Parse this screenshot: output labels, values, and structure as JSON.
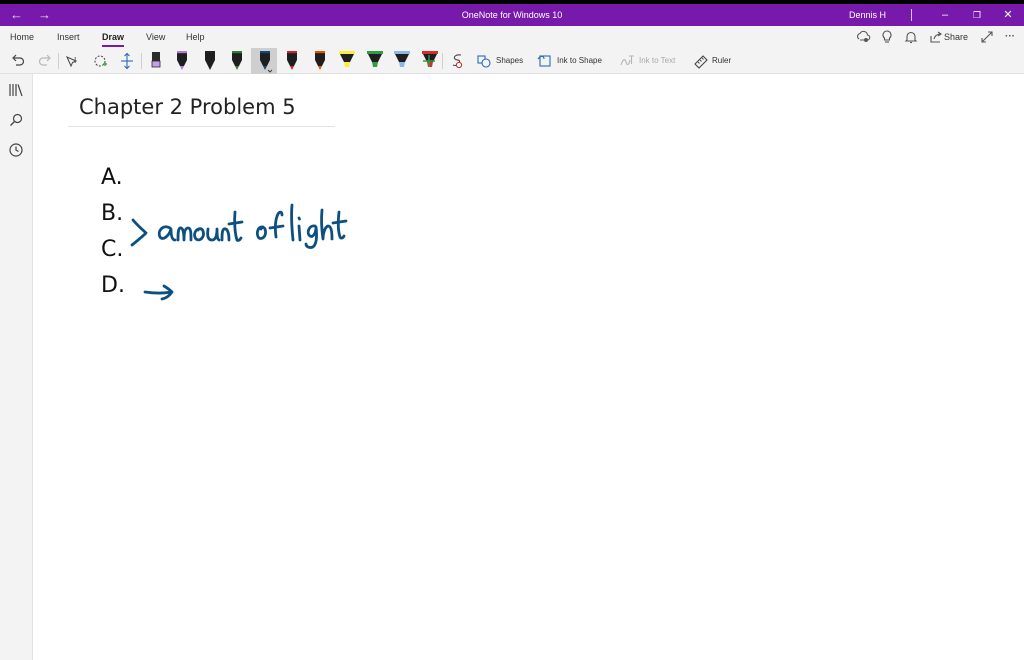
{
  "titlebar": {
    "back": "←",
    "forward": "→",
    "title": "OneNote for Windows 10",
    "user": "Dennis H",
    "minimize": "–",
    "restore": "❐",
    "close": "✕"
  },
  "menu": {
    "tabs": [
      "Home",
      "Insert",
      "Draw",
      "View",
      "Help"
    ],
    "active_tab": "Draw",
    "share_label": "Share",
    "more": "···"
  },
  "toolbar": {
    "shapes_label": "Shapes",
    "ink_to_shape_label": "Ink to Shape",
    "ink_to_text_label": "Ink to Text",
    "ruler_label": "Ruler",
    "pens": [
      {
        "kind": "pen",
        "color": "#b07ad6"
      },
      {
        "kind": "pen",
        "color": "#222222"
      },
      {
        "kind": "pen",
        "color": "#2e7d32"
      },
      {
        "kind": "pen",
        "color": "#0b4a7a",
        "selected": true
      },
      {
        "kind": "pen",
        "color": "#c62828"
      },
      {
        "kind": "pen",
        "color": "#e65100"
      },
      {
        "kind": "highlighter",
        "color": "#ffeb3b"
      },
      {
        "kind": "highlighter",
        "color": "#2e9e3e"
      },
      {
        "kind": "highlighter",
        "color": "#8fb6e6"
      },
      {
        "kind": "highlighter",
        "color": "#d32f2f"
      }
    ]
  },
  "page": {
    "title": "Chapter 2 Problem 5",
    "items": [
      "A.",
      "B.",
      "C.",
      "D."
    ],
    "ink_color": "#0d4f80",
    "handwritten_b": "amount of light"
  }
}
